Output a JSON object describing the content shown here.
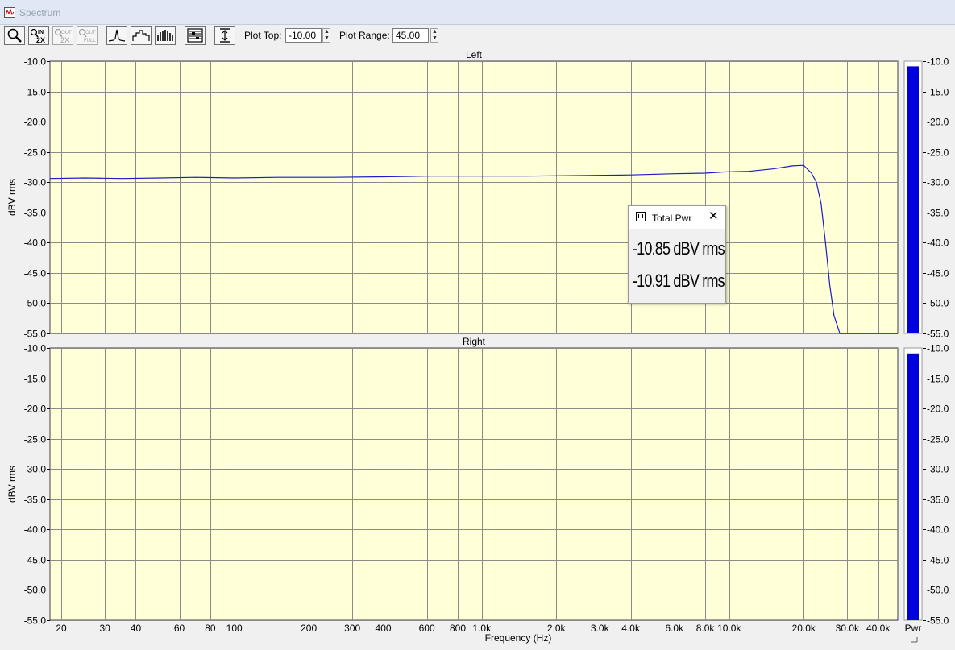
{
  "window": {
    "title": "Spectrum",
    "icon": "spectrum-window-icon"
  },
  "toolbar": {
    "buttons": [
      {
        "name": "zoom-button",
        "icon": "magnifier-icon",
        "enabled": true
      },
      {
        "name": "zoom-in-2x-button",
        "icon": "zoom-in-2x-icon",
        "enabled": true
      },
      {
        "name": "zoom-out-2x-button",
        "icon": "zoom-out-2x-icon",
        "enabled": false
      },
      {
        "name": "zoom-out-full-button",
        "icon": "zoom-out-full-icon",
        "enabled": false
      },
      {
        "name": "line-display-button",
        "icon": "line-spectrum-icon",
        "enabled": true
      },
      {
        "name": "step-display-button",
        "icon": "step-spectrum-icon",
        "enabled": true
      },
      {
        "name": "bar-display-button",
        "icon": "bar-spectrum-icon",
        "enabled": true
      },
      {
        "name": "settings-button",
        "icon": "settings-icon",
        "enabled": true
      },
      {
        "name": "autoscale-button",
        "icon": "autoscale-icon",
        "enabled": true
      }
    ],
    "zoom_in_badge": {
      "top": "IN",
      "bottom": "2X"
    },
    "zoom_out_badge": {
      "top": "OUT",
      "bottom": "2X"
    },
    "zoom_full_badge": {
      "top": "OUT",
      "bottom": "FULL"
    },
    "plot_top_label": "Plot Top:",
    "plot_top_value": "-10.00",
    "plot_range_label": "Plot Range:",
    "plot_range_value": "45.00"
  },
  "chart_data": [
    {
      "type": "line",
      "title": "Left",
      "ylabel": "dBV rms",
      "xlabel": "",
      "xscale": "log",
      "xlim": [
        18,
        48000
      ],
      "ylim": [
        -55,
        -10
      ],
      "yticks": [
        "-10.0",
        "-15.0",
        "-20.0",
        "-25.0",
        "-30.0",
        "-35.0",
        "-40.0",
        "-45.0",
        "-50.0",
        "-55.0"
      ],
      "grid": true,
      "background": "#ffffd8",
      "series": [
        {
          "color": "#1c1cc8",
          "points": [
            [
              18,
              -29.4
            ],
            [
              25,
              -29.3
            ],
            [
              35,
              -29.4
            ],
            [
              50,
              -29.3
            ],
            [
              70,
              -29.2
            ],
            [
              100,
              -29.3
            ],
            [
              150,
              -29.2
            ],
            [
              250,
              -29.2
            ],
            [
              400,
              -29.1
            ],
            [
              600,
              -29.0
            ],
            [
              900,
              -29.0
            ],
            [
              1500,
              -29.0
            ],
            [
              2500,
              -28.9
            ],
            [
              4000,
              -28.8
            ],
            [
              6000,
              -28.6
            ],
            [
              8000,
              -28.5
            ],
            [
              9500,
              -28.3
            ],
            [
              12000,
              -28.2
            ],
            [
              15000,
              -27.8
            ],
            [
              18000,
              -27.3
            ],
            [
              20000,
              -27.2
            ],
            [
              21500,
              -28.5
            ],
            [
              22500,
              -30.0
            ],
            [
              23500,
              -33.5
            ],
            [
              24500,
              -40.0
            ],
            [
              25500,
              -47.0
            ],
            [
              26500,
              -52.0
            ],
            [
              28000,
              -55.0
            ],
            [
              48000,
              -55.0
            ]
          ]
        }
      ]
    },
    {
      "type": "line",
      "title": "Right",
      "ylabel": "dBV rms",
      "xlabel": "Frequency (Hz)",
      "xscale": "log",
      "xlim": [
        18,
        48000
      ],
      "ylim": [
        -55,
        -10
      ],
      "yticks": [
        "-10.0",
        "-15.0",
        "-20.0",
        "-25.0",
        "-30.0",
        "-35.0",
        "-40.0",
        "-45.0",
        "-50.0",
        "-55.0"
      ],
      "xticks": [
        {
          "value": 20,
          "label": "20"
        },
        {
          "value": 30,
          "label": "30"
        },
        {
          "value": 40,
          "label": "40"
        },
        {
          "value": 60,
          "label": "60"
        },
        {
          "value": 80,
          "label": "80"
        },
        {
          "value": 100,
          "label": "100"
        },
        {
          "value": 200,
          "label": "200"
        },
        {
          "value": 300,
          "label": "300"
        },
        {
          "value": 400,
          "label": "400"
        },
        {
          "value": 600,
          "label": "600"
        },
        {
          "value": 800,
          "label": "800"
        },
        {
          "value": 1000,
          "label": "1.0k"
        },
        {
          "value": 2000,
          "label": "2.0k"
        },
        {
          "value": 3000,
          "label": "3.0k"
        },
        {
          "value": 4000,
          "label": "4.0k"
        },
        {
          "value": 6000,
          "label": "6.0k"
        },
        {
          "value": 8000,
          "label": "8.0k"
        },
        {
          "value": 10000,
          "label": "10.0k"
        },
        {
          "value": 20000,
          "label": "20.0k"
        },
        {
          "value": 30000,
          "label": "30.0k"
        },
        {
          "value": 40000,
          "label": "40.0k"
        }
      ],
      "grid": true,
      "background": "#ffffd8",
      "series": []
    }
  ],
  "meters": {
    "label": "Pwr",
    "color": "#0000dd",
    "left_level_dB": -10.85,
    "right_level_dB": -10.91,
    "ylim": [
      -55,
      -10
    ]
  },
  "total_power_popup": {
    "title": "Total Pwr",
    "left_value": "-10.85 dBV rms",
    "right_value": "-10.91 dBV rms"
  }
}
